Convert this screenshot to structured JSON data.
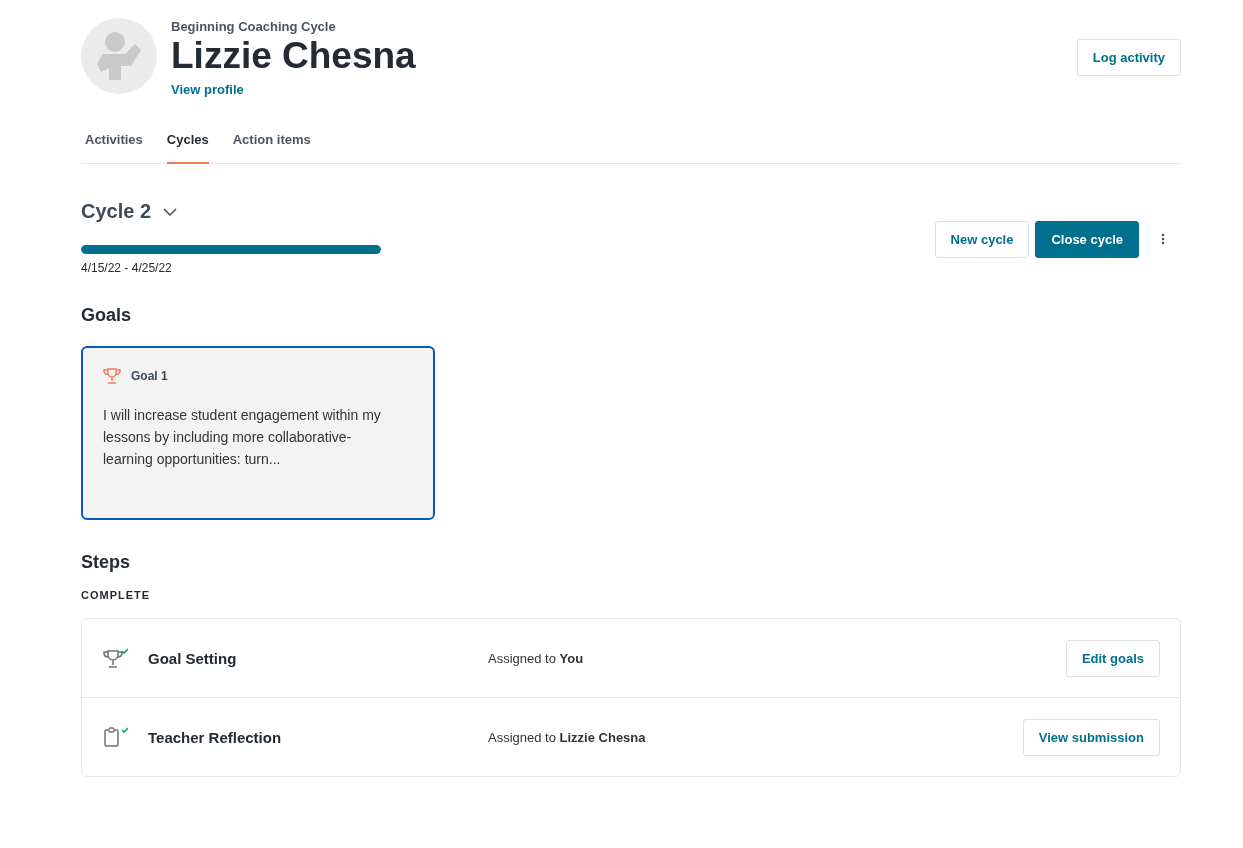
{
  "header": {
    "subtitle": "Beginning Coaching Cycle",
    "name": "Lizzie Chesna",
    "profile_link": "View profile",
    "log_button": "Log activity"
  },
  "tabs": [
    {
      "label": "Activities",
      "selected": false
    },
    {
      "label": "Cycles",
      "selected": true
    },
    {
      "label": "Action items",
      "selected": false
    }
  ],
  "cycle": {
    "title": "Cycle 2",
    "level": 1,
    "dates": "4/15/22 - 4/25/22",
    "buttons": [
      "New cycle",
      "Close cycle"
    ]
  },
  "goals": {
    "heading": "Goals",
    "items": [
      {
        "label": "Goal 1",
        "text": "I will increase student engagement within my lessons by including more collaborative-learning opportunities: turn...",
        "selected": true
      }
    ]
  },
  "steps": {
    "heading": "Steps",
    "group": "COMPLETE",
    "items": [
      {
        "kind": "trophy",
        "title": "Goal Setting",
        "assigned": "Assigned to **You**",
        "button": "Edit goals"
      },
      {
        "kind": "clipboard",
        "title": "Teacher Reflection",
        "assigned": "Assigned to **Lizzie Chesna**",
        "button": "View submission"
      }
    ]
  }
}
